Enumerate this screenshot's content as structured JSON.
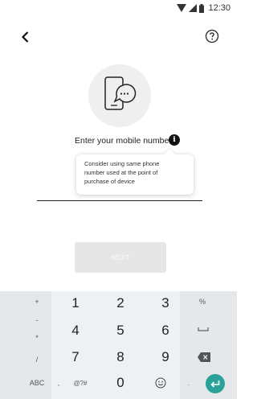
{
  "status_bar": {
    "time": "12:30",
    "icons": [
      "wifi-icon",
      "signal-icon",
      "battery-icon"
    ]
  },
  "top_bar": {
    "back_icon": "chevron-left-icon",
    "help_icon": "question-circle-icon"
  },
  "hero": {
    "icon": "phone-chat-icon"
  },
  "form": {
    "prompt": "Enter your mobile number",
    "info_icon_glyph": "i",
    "tooltip_line1": "Consider using same phone",
    "tooltip_line2": "number used at the point of",
    "tooltip_line3": "purchase of device",
    "input_value": ""
  },
  "actions": {
    "next_label": "NEXT"
  },
  "keyboard": {
    "left_col": [
      "+",
      "-",
      "*",
      "/",
      "ABC",
      ","
    ],
    "digits": [
      "1",
      "2",
      "3",
      "4",
      "5",
      "6",
      "7",
      "8",
      "9",
      "0"
    ],
    "bottom": {
      "sym": "@?#",
      "dot": "."
    },
    "right_col": [
      "%"
    ]
  },
  "colors": {
    "accent": "#2aa29a",
    "disabled_button": "#e6e6e6",
    "keyboard_bg": "#eef1f3"
  }
}
